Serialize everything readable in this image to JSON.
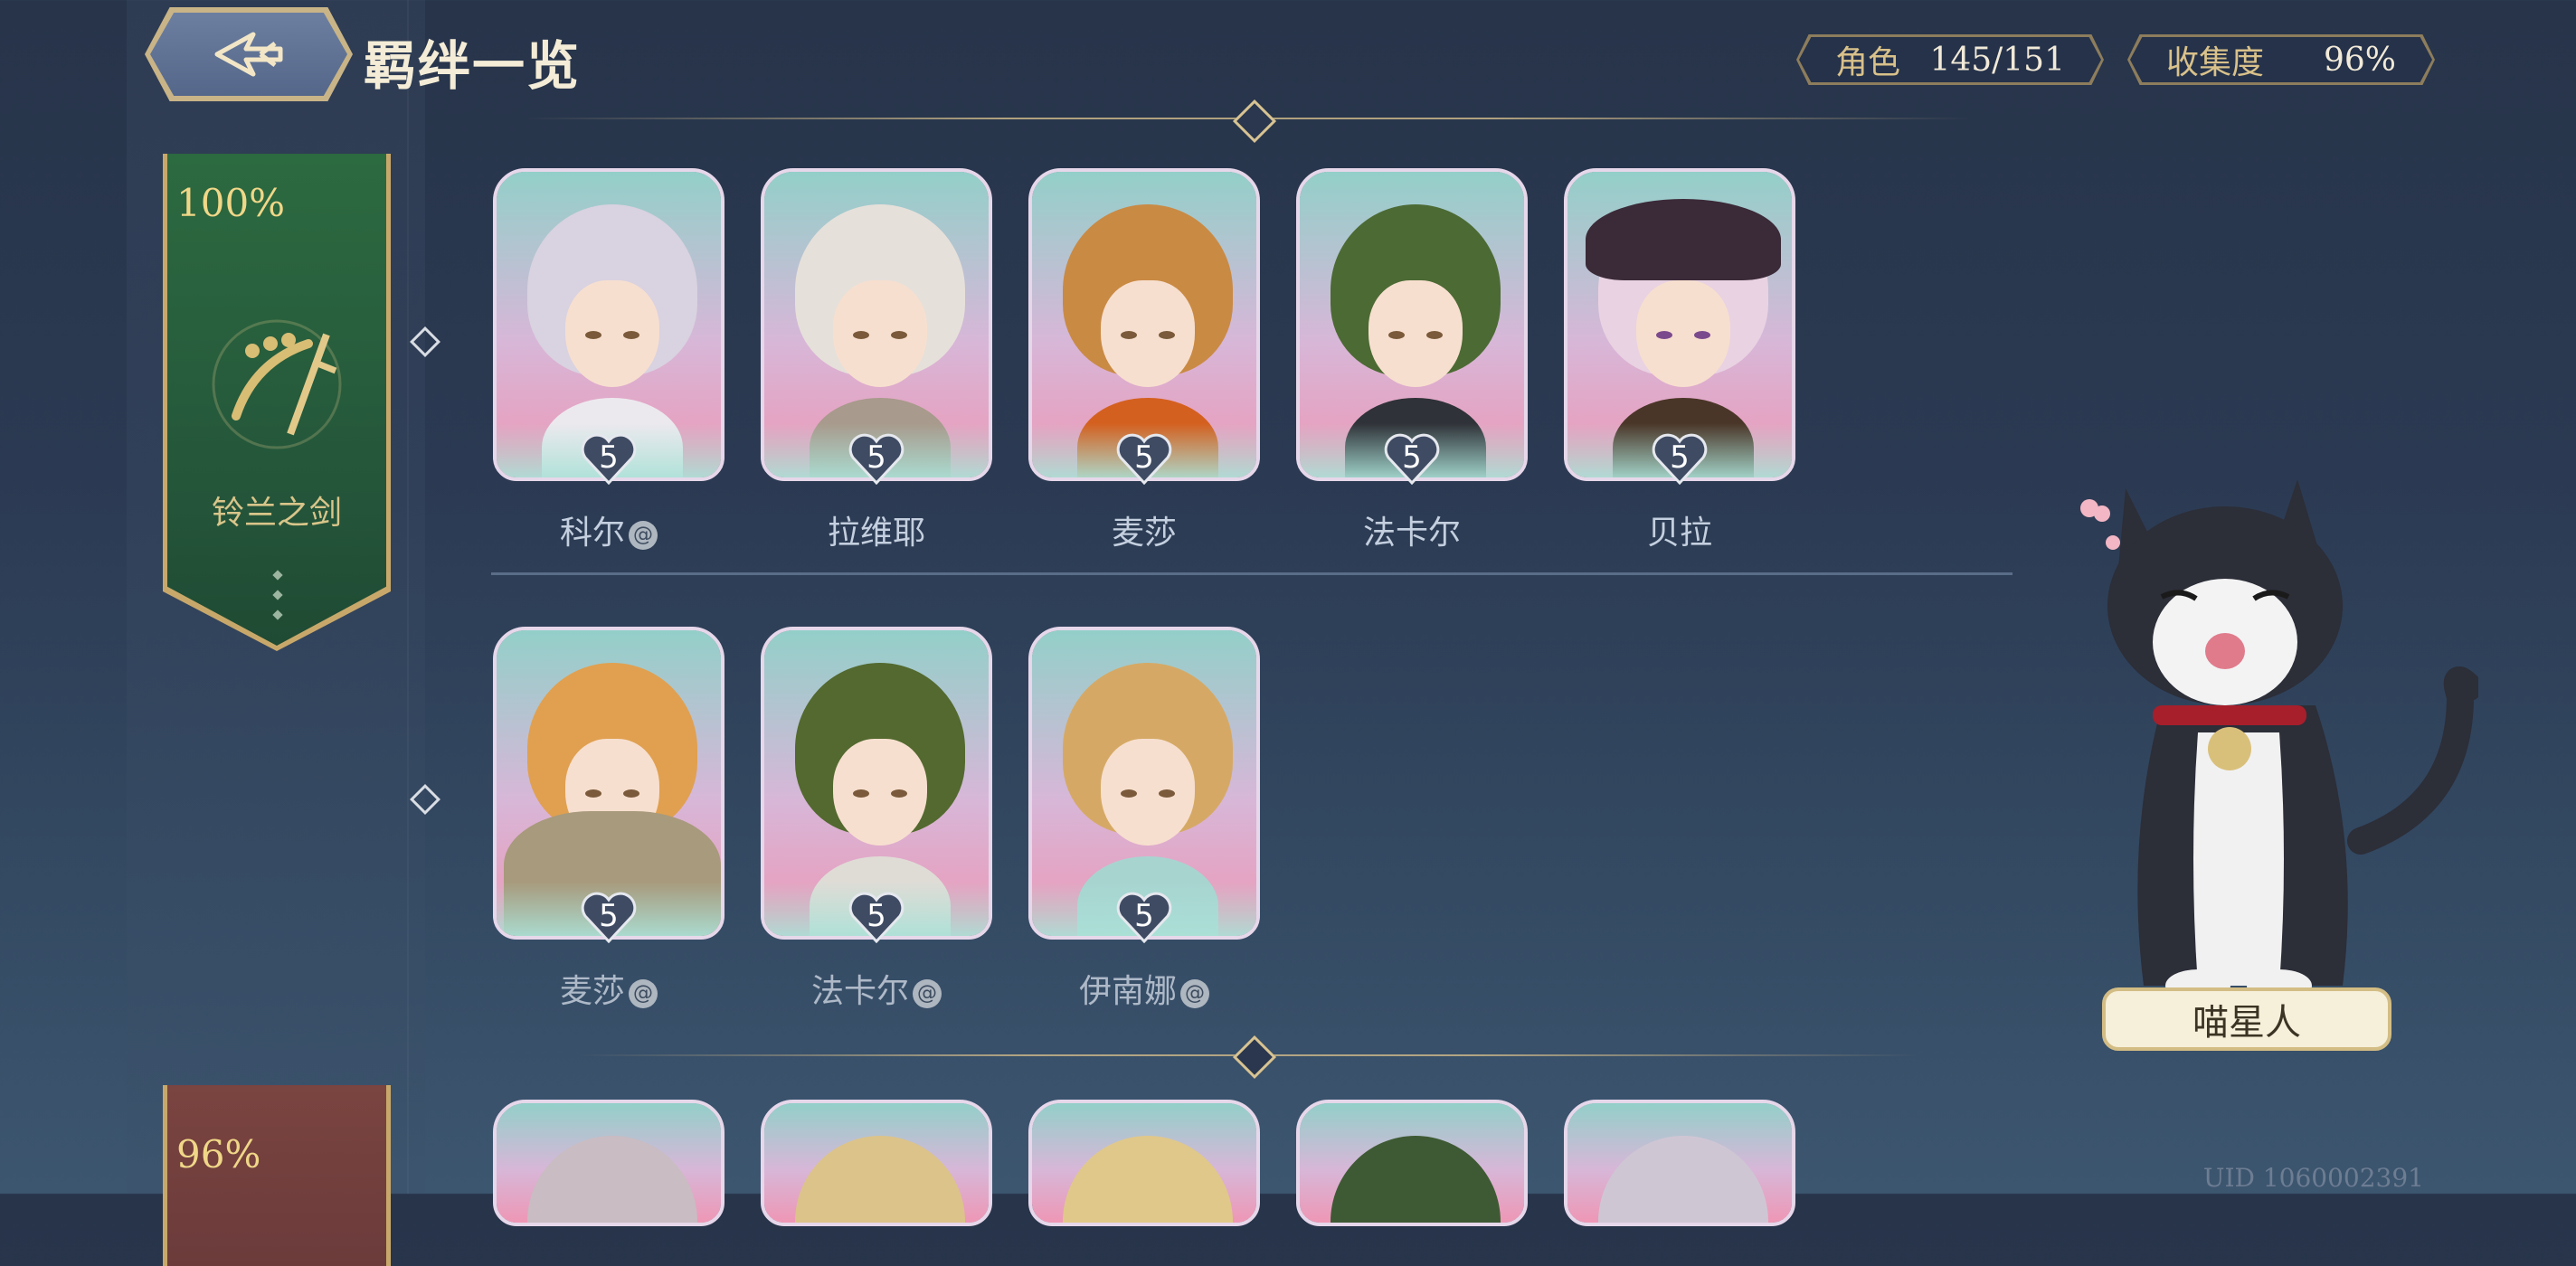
{
  "header": {
    "title": "羁绊一览",
    "stats": [
      {
        "label": "角色",
        "value": "145/151"
      },
      {
        "label": "收集度",
        "value": "96%"
      }
    ]
  },
  "groups": [
    {
      "percent": "100%",
      "name": "铃兰之剑",
      "color": "#2d5a3a"
    },
    {
      "percent": "96%",
      "name": "",
      "color": "#6b3b3b"
    }
  ],
  "row1": [
    {
      "name": "科尔",
      "level": "5",
      "badge": true
    },
    {
      "name": "拉维耶",
      "level": "5",
      "badge": false
    },
    {
      "name": "麦莎",
      "level": "5",
      "badge": false
    },
    {
      "name": "法卡尔",
      "level": "5",
      "badge": false
    },
    {
      "name": "贝拉",
      "level": "5",
      "badge": false
    }
  ],
  "row2": [
    {
      "name": "麦莎",
      "level": "5",
      "badge": true
    },
    {
      "name": "法卡尔",
      "level": "5",
      "badge": true
    },
    {
      "name": "伊南娜",
      "level": "5",
      "badge": true
    }
  ],
  "cat": {
    "name": "喵星人"
  },
  "uid": "UID 1060002391",
  "icons": {
    "back": "back-arrow-icon",
    "badge": "swirl-badge-icon",
    "heart": "heart-level-icon",
    "emblem": "sword-emblem-icon"
  }
}
